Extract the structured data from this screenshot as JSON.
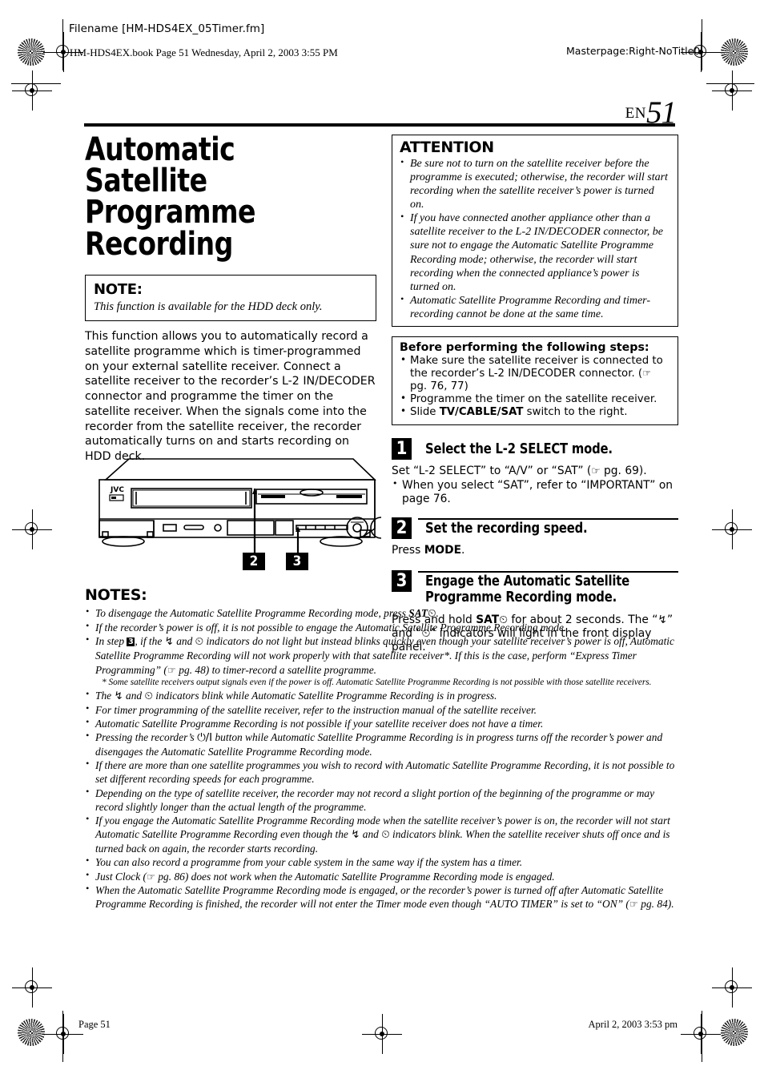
{
  "header": {
    "filename": "Filename [HM-HDS4EX_05Timer.fm]",
    "book_line": "HM-HDS4EX.book  Page 51  Wednesday, April 2, 2003  3:55 PM",
    "masterpage": "Masterpage:Right-NoTitle0"
  },
  "page_marker": {
    "language": "EN",
    "number": "51"
  },
  "title": "Automatic Satellite Programme Recording",
  "note_box": {
    "heading": "NOTE:",
    "text": "This function is available for the HDD deck only."
  },
  "intro_paragraph": "This function allows you to automatically record a satellite programme which is timer-programmed on your external satellite receiver. Connect a satellite receiver to the recorder’s L-2 IN/DECODER connector and programme the timer on the satellite receiver. When the signals come into the recorder from the satellite receiver, the recorder automatically turns on and starts recording on HDD deck.",
  "illustration": {
    "brand": "JVC",
    "callout_2": "2",
    "callout_3": "3"
  },
  "attention_box": {
    "heading": "ATTENTION",
    "items": [
      "Be sure not to turn on the satellite receiver before the programme is executed; otherwise, the recorder will start recording when the satellite receiver’s power is turned on.",
      "If you have connected another appliance other than a satellite receiver to the L-2 IN/DECODER connector, be sure not to engage the Automatic Satellite Programme Recording mode; otherwise, the recorder will start recording when the connected appliance’s power is turned on.",
      "Automatic Satellite Programme Recording and timer-recording cannot be done at the same time."
    ]
  },
  "before_box": {
    "heading": "Before performing the following steps:",
    "item1_pre": "Make sure the satellite receiver is connected to the recorder’s L-2 IN/DECODER connector. (",
    "item1_ref": " pg. 76, 77)",
    "item2": "Programme the timer on the satellite receiver.",
    "item3_pre": "Slide ",
    "item3_bold": "TV/CABLE/SAT",
    "item3_post": " switch to the right."
  },
  "steps": [
    {
      "number": "1",
      "title": "Select the L-2 SELECT mode.",
      "body_pre": "Set “L-2 SELECT” to “A/V” or “SAT” (",
      "body_post": " pg. 69).",
      "sub": "When you select “SAT”, refer to “IMPORTANT” on page 76."
    },
    {
      "number": "2",
      "title": "Set the recording speed.",
      "body_pre": "Press ",
      "body_bold": "MODE",
      "body_post": "."
    },
    {
      "number": "3",
      "title": "Engage the Automatic Satellite Programme Recording mode.",
      "body_pre": "Press and hold ",
      "body_bold": "SAT",
      "body_mid": " for about 2 seconds. The “",
      "body_mid2": "” and “",
      "body_post": "” indicators will light in the front display panel."
    }
  ],
  "notes_section": {
    "heading": "NOTES:",
    "items": [
      {
        "pre": "To disengage the Automatic Satellite Programme Recording mode, press ",
        "bold": "SAT",
        "post": "."
      },
      {
        "pre": "If the recorder’s power is off, it is not possible to engage the Automatic Satellite Programme Recording mode."
      },
      {
        "pre": "In step ",
        "step_ref": "3",
        "mid": ", if the ",
        "mid2": " and ",
        "mid3": " indicators do not light but instead blinks quickly even though your satellite receiver’s power is off, Automatic Satellite Programme Recording will not work properly with that satellite receiver*. If this is the case, perform “Express Timer Programming” (",
        "post": " pg. 48) to timer-record a satellite programme.",
        "footnote": "* Some satellite receivers output signals even if the power is off. Automatic Satellite Programme Recording is not possible with those satellite receivers."
      },
      {
        "pre": "The ",
        "mid2": " and ",
        "post": " indicators blink while Automatic Satellite Programme Recording is in progress."
      },
      {
        "pre": "For timer programming of the satellite receiver, refer to the instruction manual of the satellite receiver."
      },
      {
        "pre": "Automatic Satellite Programme Recording is not possible if your satellite receiver does not have a timer."
      },
      {
        "pre": "Pressing the recorder’s ",
        "post": " button while Automatic Satellite Programme Recording is in progress turns off the recorder’s power and disengages the Automatic Satellite Programme Recording mode."
      },
      {
        "pre": "If there are more than one satellite programmes you wish to record with Automatic Satellite Programme Recording, it is not possible to set different recording speeds for each programme."
      },
      {
        "pre": "Depending on the type of satellite receiver, the recorder may not record a slight portion of the beginning of the programme or may record slightly longer than the actual length of the programme."
      },
      {
        "pre": "If you engage the Automatic Satellite Programme Recording mode when the satellite receiver’s power is on, the recorder will not start Automatic Satellite Programme Recording even though the ",
        "mid2": " and ",
        "post": " indicators blink. When the satellite receiver shuts off once and is turned back on again, the recorder starts recording."
      },
      {
        "pre": "You can also record a programme from your cable system in the same way if the system has a timer."
      },
      {
        "pre": "Just Clock (",
        "post": " pg. 86) does not work when the Automatic Satellite Programme Recording mode is engaged."
      },
      {
        "pre": "When the Automatic Satellite Programme Recording mode is engaged, or the recorder’s power is turned off after Automatic Satellite Programme Recording is finished, the recorder will not enter the Timer mode even though “AUTO TIMER” is set to “ON” (",
        "post": " pg. 84)."
      }
    ]
  },
  "footer": {
    "page_label": "Page 51",
    "date_label": "April 2, 2003 3:53 pm"
  },
  "icons": {
    "pointing_hand": "☞",
    "satellite_dish": "↯",
    "clock": "⏲",
    "power": "⏻/I"
  }
}
